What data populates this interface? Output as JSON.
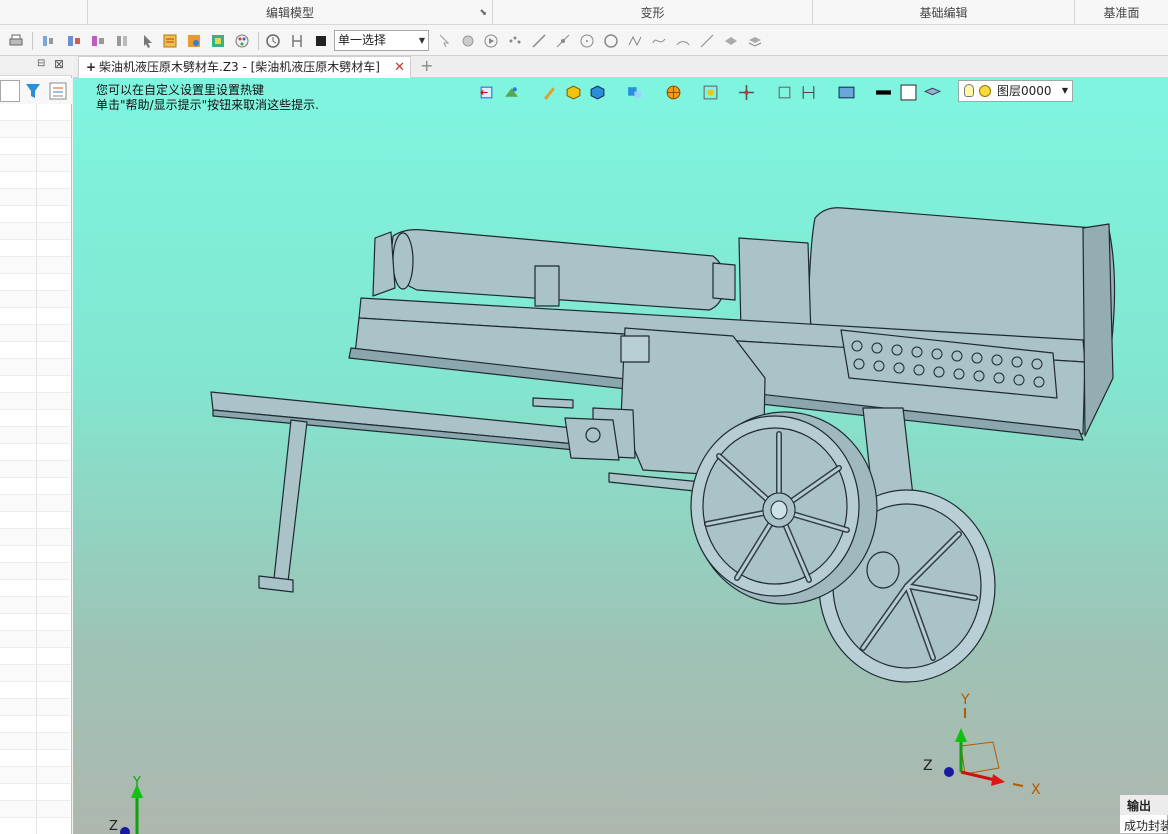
{
  "ribbon": {
    "groups": [
      "编辑模型",
      "变形",
      "基础编辑",
      "基准面"
    ]
  },
  "toolbar": {
    "selection_mode": "单一选择"
  },
  "document_tab": {
    "title": "柴油机液压原木劈材车.Z3 - [柴油机液压原木劈材车]",
    "pin_symbol": "+",
    "close_symbol": "✕",
    "new_tab_symbol": "+"
  },
  "viewport": {
    "hint_line1": "您可以在自定义设置里设置热键",
    "hint_line2": "单击\"帮助/显示提示\"按钮来取消这些提示.",
    "layer": "图层0000",
    "triad": {
      "x_label": "X",
      "y_label": "Y",
      "z_label": "Z"
    },
    "background_top": "#7ff5e0",
    "background_bottom": "#aeb7ae",
    "model_fill": "#a9c3c9",
    "model_stroke": "#1f2a30"
  },
  "output_panel": {
    "title": "输出",
    "message": "成功封装"
  },
  "left_panel": {
    "icons": [
      "restore-icon",
      "close-icon",
      "filter-icon",
      "settings-list-icon"
    ]
  }
}
